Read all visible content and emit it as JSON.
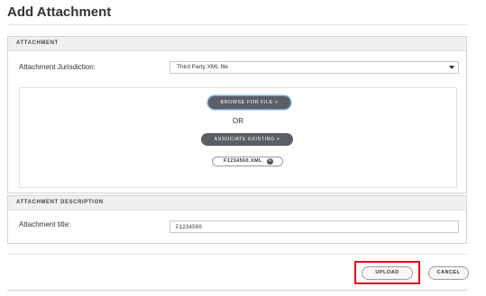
{
  "dialog": {
    "title": "Add Attachment"
  },
  "attachment_section": {
    "header": "ATTACHMENT",
    "jurisdiction_label": "Attachment Jurisdiction:",
    "jurisdiction_value": "Third Party XML file",
    "browse_button": "BROWSE FOR FILE >",
    "or_text": "OR",
    "associate_button": "ASSOCIATE EXISTING >",
    "file_chip": "F1234560.XML",
    "remove_icon": "close-circle-icon"
  },
  "description_section": {
    "header": "ATTACHMENT DESCRIPTION",
    "title_label": "Attachment title:",
    "title_value": "F1234560"
  },
  "footer": {
    "upload_button": "UPLOAD",
    "cancel_button": "CANCEL",
    "highlight_color": "#e0101a"
  }
}
